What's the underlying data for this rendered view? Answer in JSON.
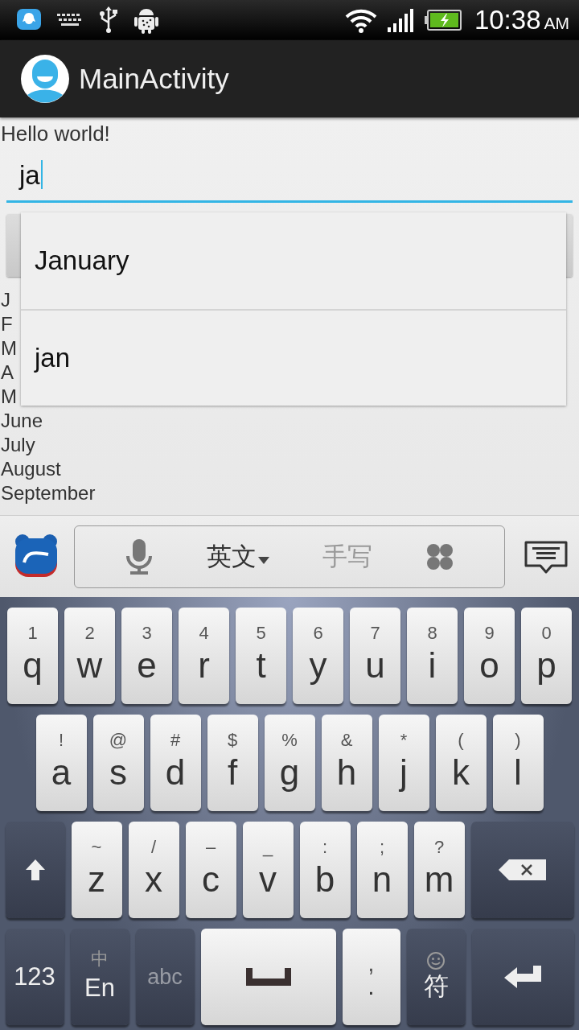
{
  "status_bar": {
    "time": "10:38",
    "meridiem": "AM"
  },
  "app_bar": {
    "title": "MainActivity"
  },
  "content": {
    "greeting": "Hello world!",
    "input": {
      "value": "ja",
      "focused": true
    },
    "list": [
      "J",
      "F",
      "M",
      "A",
      "M",
      "June",
      "July",
      "August",
      "September"
    ]
  },
  "suggestions": [
    {
      "label": "January"
    },
    {
      "label": "jan"
    }
  ],
  "ime_toolbar": {
    "modes": [
      {
        "label": "英文",
        "selected": true
      },
      {
        "label": "手写",
        "selected": false
      }
    ]
  },
  "keyboard": {
    "rows": [
      [
        {
          "kind": "char",
          "hint": "1",
          "label": "q"
        },
        {
          "kind": "char",
          "hint": "2",
          "label": "w"
        },
        {
          "kind": "char",
          "hint": "3",
          "label": "e"
        },
        {
          "kind": "char",
          "hint": "4",
          "label": "r"
        },
        {
          "kind": "char",
          "hint": "5",
          "label": "t"
        },
        {
          "kind": "char",
          "hint": "6",
          "label": "y"
        },
        {
          "kind": "char",
          "hint": "7",
          "label": "u"
        },
        {
          "kind": "char",
          "hint": "8",
          "label": "i"
        },
        {
          "kind": "char",
          "hint": "9",
          "label": "o"
        },
        {
          "kind": "char",
          "hint": "0",
          "label": "p"
        }
      ],
      [
        {
          "kind": "char",
          "hint": "!",
          "label": "a"
        },
        {
          "kind": "char",
          "hint": "@",
          "label": "s"
        },
        {
          "kind": "char",
          "hint": "#",
          "label": "d"
        },
        {
          "kind": "char",
          "hint": "$",
          "label": "f"
        },
        {
          "kind": "char",
          "hint": "%",
          "label": "g"
        },
        {
          "kind": "char",
          "hint": "&",
          "label": "h"
        },
        {
          "kind": "char",
          "hint": "*",
          "label": "j"
        },
        {
          "kind": "char",
          "hint": "(",
          "label": "k"
        },
        {
          "kind": "char",
          "hint": ")",
          "label": "l"
        }
      ],
      [
        {
          "kind": "shift"
        },
        {
          "kind": "char",
          "hint": "~",
          "label": "z"
        },
        {
          "kind": "char",
          "hint": "/",
          "label": "x"
        },
        {
          "kind": "char",
          "hint": "–",
          "label": "c"
        },
        {
          "kind": "char",
          "hint": "_",
          "label": "v"
        },
        {
          "kind": "char",
          "hint": ":",
          "label": "b"
        },
        {
          "kind": "char",
          "hint": ";",
          "label": "n"
        },
        {
          "kind": "char",
          "hint": "?",
          "label": "m"
        },
        {
          "kind": "backspace"
        }
      ]
    ],
    "bottom_row": [
      {
        "kind": "mode",
        "label": "123",
        "disabled": false
      },
      {
        "kind": "mode",
        "hint": "中",
        "label": "En",
        "disabled": false
      },
      {
        "kind": "mode",
        "label": "abc",
        "disabled": true
      },
      {
        "kind": "space",
        "disabled": false
      },
      {
        "kind": "char",
        "hint": ",",
        "label": ".",
        "disabled": false
      },
      {
        "kind": "symbol",
        "label": "符",
        "disabled": false
      },
      {
        "kind": "enter",
        "disabled": false
      }
    ]
  }
}
